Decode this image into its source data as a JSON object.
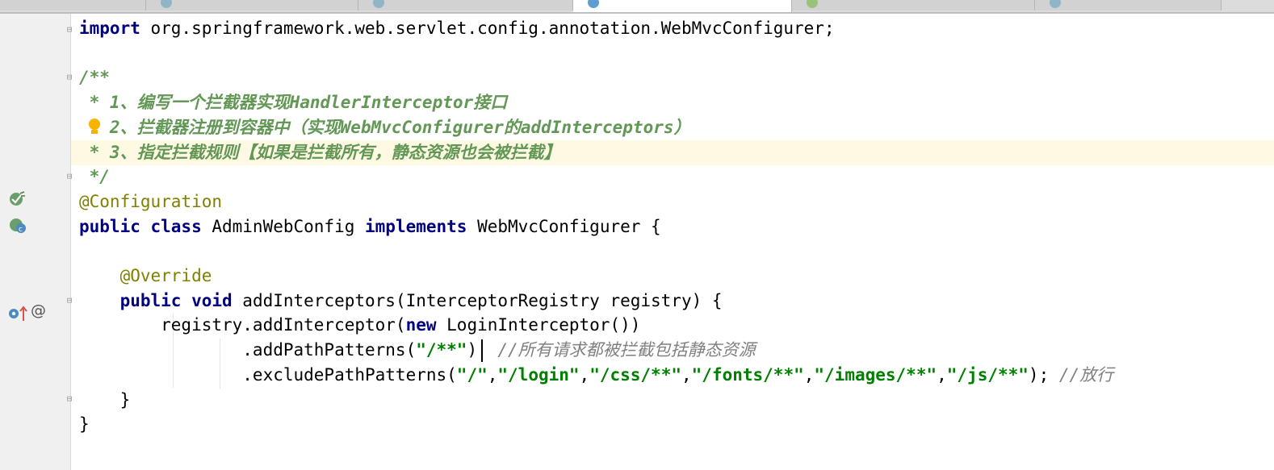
{
  "tabs": [
    {
      "label": ""
    },
    {
      "label": ""
    },
    {
      "label": ""
    },
    {
      "label": ""
    },
    {
      "label": ""
    },
    {
      "label": ""
    }
  ],
  "gutter": {
    "icons": [
      "bean-config-icon",
      "bean-class-icon",
      "override-up-arrow-icon"
    ],
    "at_symbol": "@"
  },
  "editor": {
    "file_language": "Java",
    "highlighted_line": 6,
    "lines": [
      "import org.springframework.web.servlet.config.annotation.WebMvcConfigurer;",
      "",
      "/**",
      " * 1、编写一个拦截器实现HandlerInterceptor接口",
      " * 2、拦截器注册到容器中（实现WebMvcConfigurer的addInterceptors）",
      " * 3、指定拦截规则【如果是拦截所有，静态资源也会被拦截】",
      " */",
      "@Configuration",
      "public class AdminWebConfig implements WebMvcConfigurer {",
      "",
      "    @Override",
      "    public void addInterceptors(InterceptorRegistry registry) {",
      "        registry.addInterceptor(new LoginInterceptor())",
      "                .addPathPatterns(\"/**\")  //所有请求都被拦截包括静态资源",
      "                .excludePathPatterns(\"/\",\"/login\",\"/css/**\",\"/fonts/**\",\"/images/**\",\"/js/**\"); //放行",
      "    }",
      "}"
    ]
  },
  "colors": {
    "keyword": "#000080",
    "doc_comment": "#629755",
    "line_comment": "#808080",
    "annotation": "#808000",
    "string": "#008000",
    "gutter_bg": "#f0f0f0",
    "current_line_bg": "#fdf9e3"
  }
}
